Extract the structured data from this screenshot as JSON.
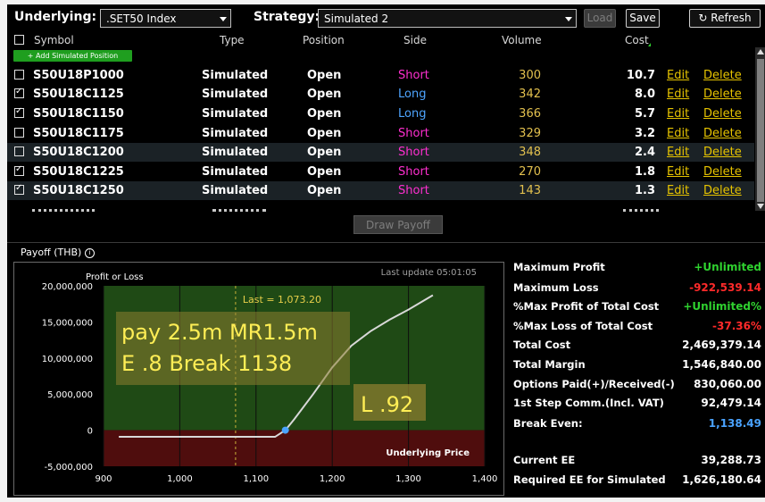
{
  "topbar": {
    "underlying_label": "Underlying:",
    "underlying_value": ".SET50 Index",
    "strategy_label": "Strategy:",
    "strategy_value": "Simulated 2",
    "load_label": "Load",
    "save_label": "Save",
    "refresh_label": "Refresh"
  },
  "table": {
    "columns": {
      "symbol": "Symbol",
      "type": "Type",
      "position": "Position",
      "side": "Side",
      "volume": "Volume",
      "cost": "Cost"
    },
    "add_label": "+ Add Simulated Position",
    "edit_label": "Edit",
    "delete_label": "Delete",
    "rows": [
      {
        "checked": false,
        "symbol": "S50U18P1000",
        "type": "Simulated",
        "position": "Open",
        "side": "Short",
        "volume": "300",
        "cost": "10.7"
      },
      {
        "checked": true,
        "symbol": "S50U18C1125",
        "type": "Simulated",
        "position": "Open",
        "side": "Long",
        "volume": "342",
        "cost": "8.0"
      },
      {
        "checked": true,
        "symbol": "S50U18C1150",
        "type": "Simulated",
        "position": "Open",
        "side": "Long",
        "volume": "366",
        "cost": "5.7"
      },
      {
        "checked": false,
        "symbol": "S50U18C1175",
        "type": "Simulated",
        "position": "Open",
        "side": "Short",
        "volume": "329",
        "cost": "3.2"
      },
      {
        "checked": false,
        "symbol": "S50U18C1200",
        "type": "Simulated",
        "position": "Open",
        "side": "Short",
        "volume": "348",
        "cost": "2.4"
      },
      {
        "checked": true,
        "symbol": "S50U18C1225",
        "type": "Simulated",
        "position": "Open",
        "side": "Short",
        "volume": "270",
        "cost": "1.8"
      },
      {
        "checked": true,
        "symbol": "S50U18C1250",
        "type": "Simulated",
        "position": "Open",
        "side": "Short",
        "volume": "143",
        "cost": "1.3"
      }
    ]
  },
  "draw_payoff_label": "Draw Payoff",
  "payoff_title": "Payoff (THB)",
  "chart": {
    "ylabel": "Profit or Loss",
    "last_update": "Last update 05:01:05",
    "xlabel": "Underlying Price",
    "last_label": "Last = 1,073.20",
    "yticks": [
      "20,000,000",
      "15,000,000",
      "10,000,000",
      "5,000,000",
      "0",
      "-5,000,000"
    ],
    "xticks": [
      "900",
      "1,000",
      "1,100",
      "1,200",
      "1,300",
      "1,400"
    ],
    "annotations": {
      "line1": "pay 2.5m MR1.5m",
      "line2": "E .8 Break 1138",
      "box2": "L .92"
    },
    "colors": {
      "profit_zone": "#1f4a15",
      "loss_zone": "#4f0d0d",
      "line": "#d8d8d8",
      "marker": "#4aa3ff"
    }
  },
  "chart_data": {
    "type": "line",
    "xlim": [
      900,
      1400
    ],
    "ylim": [
      -5000000,
      20000000
    ],
    "x": [
      920,
      1000,
      1050,
      1100,
      1125,
      1138.49,
      1150,
      1175,
      1200,
      1225,
      1250,
      1275,
      1300,
      1332
    ],
    "y": [
      -922539,
      -922539,
      -922539,
      -922539,
      -922539,
      0,
      1500000,
      5000000,
      8700000,
      11700000,
      13700000,
      15300000,
      16700000,
      18700000
    ],
    "break_even": 1138.49,
    "last": 1073.2
  },
  "stats": [
    {
      "label": "Maximum Profit",
      "value": "+Unlimited",
      "color": "#2fd12f"
    },
    {
      "label": "Maximum Loss",
      "value": "-922,539.14",
      "color": "#ff2a2a"
    },
    {
      "label": "%Max Profit of Total Cost",
      "value": "+Unlimited%",
      "color": "#2fd12f"
    },
    {
      "label": "%Max Loss of Total Cost",
      "value": "-37.36%",
      "color": "#ff2a2a"
    },
    {
      "label": "Total Cost",
      "value": "2,469,379.14",
      "color": "#ffffff"
    },
    {
      "label": "Total Margin",
      "value": "1,546,840.00",
      "color": "#ffffff"
    },
    {
      "label": "Options Paid(+)/Received(-)",
      "value": "830,060.00",
      "color": "#ffffff"
    },
    {
      "label": "1st Step Comm.(Incl. VAT)",
      "value": "92,479.14",
      "color": "#ffffff"
    },
    {
      "label": "Break Even:",
      "value": "1,138.49",
      "color": "#4aa3ff"
    },
    {
      "label": "Current EE",
      "value": "39,288.73",
      "color": "#ffffff"
    },
    {
      "label": "Required EE for Simulated",
      "value": "1,626,180.64",
      "color": "#ffffff"
    }
  ]
}
